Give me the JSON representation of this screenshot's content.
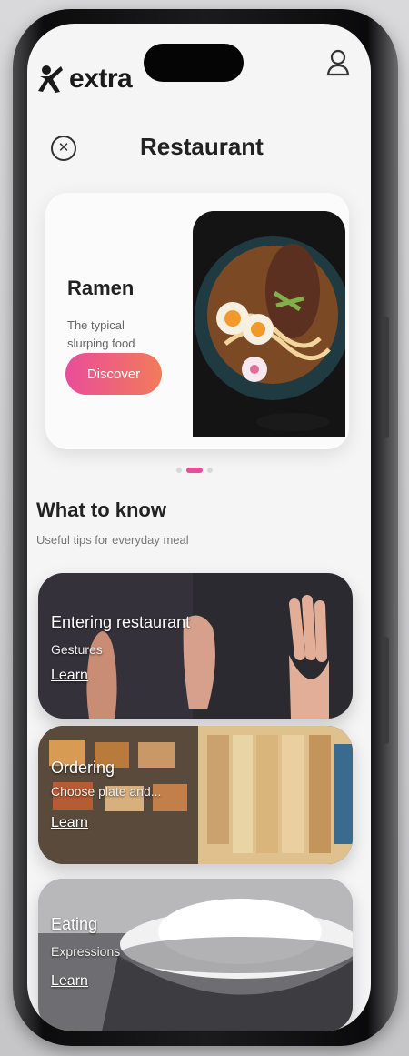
{
  "brand": {
    "name": "extra"
  },
  "header": {
    "title": "Restaurant"
  },
  "feature": {
    "title": "Ramen",
    "subtitle": "The typical slurping food",
    "button_label": "Discover"
  },
  "carousel": {
    "page": 2,
    "count": 3
  },
  "section": {
    "title": "What to know",
    "subtitle": "Useful tips for everyday meal"
  },
  "tips": [
    {
      "title": "Entering restaurant",
      "subtitle": "Gestures",
      "link": "Learn"
    },
    {
      "title": "Ordering",
      "subtitle": "Choose plate and...",
      "link": "Learn"
    },
    {
      "title": "Eating",
      "subtitle": "Expressions",
      "link": "Learn"
    }
  ],
  "colors": {
    "accent": "#e94d9a",
    "accent_end": "#f27b5a"
  }
}
